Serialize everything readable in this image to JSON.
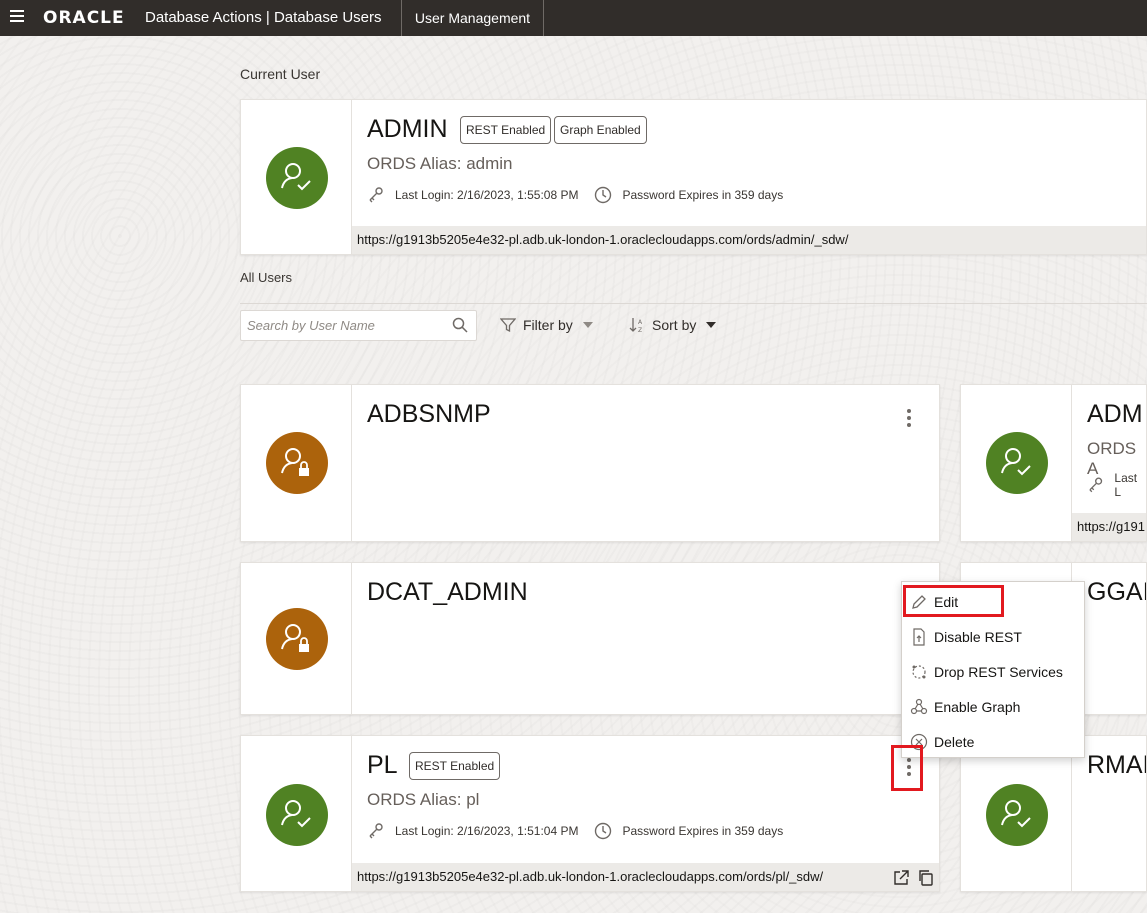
{
  "header": {
    "logo": "ORACLE",
    "app_title": "Database Actions |  Database Users",
    "tab": "User Management"
  },
  "current_user_section": {
    "label": "Current User",
    "user": {
      "name": "ADMIN",
      "badges": [
        "REST Enabled",
        "Graph Enabled"
      ],
      "alias": "ORDS Alias: admin",
      "last_login": "Last Login: 2/16/2023, 1:55:08 PM",
      "password": "Password Expires in 359 days",
      "url": "https://g1913b5205e4e32-pl.adb.uk-london-1.oraclecloudapps.com/ords/admin/_sdw/",
      "status": "active"
    }
  },
  "all_users_section": {
    "label": "All Users",
    "search_placeholder": "Search by User Name",
    "filter_label": "Filter by",
    "sort_label": "Sort by"
  },
  "user_cards": [
    {
      "name": "ADBSNMP",
      "status": "locked"
    },
    {
      "name": "ADM",
      "alias": "ORDS A",
      "last_login": "Last L",
      "url": "https://g191",
      "status": "active"
    },
    {
      "name": "DCAT_ADMIN",
      "status": "locked"
    },
    {
      "name": "GGAI",
      "status": "partial"
    },
    {
      "name": "PL",
      "badges": [
        "REST Enabled"
      ],
      "alias": "ORDS Alias: pl",
      "last_login": "Last Login: 2/16/2023, 1:51:04 PM",
      "password": "Password Expires in 359 days",
      "url": "https://g1913b5205e4e32-pl.adb.uk-london-1.oraclecloudapps.com/ords/pl/_sdw/",
      "status": "active"
    },
    {
      "name": "RMAI",
      "status": "active"
    }
  ],
  "context_menu": {
    "items": [
      "Edit",
      "Disable REST",
      "Drop REST Services",
      "Enable Graph",
      "Delete"
    ]
  },
  "colors": {
    "header_bg": "#312d2a",
    "avatar_active": "#508223",
    "avatar_locked": "#ac630c",
    "highlight": "#e2191f"
  }
}
